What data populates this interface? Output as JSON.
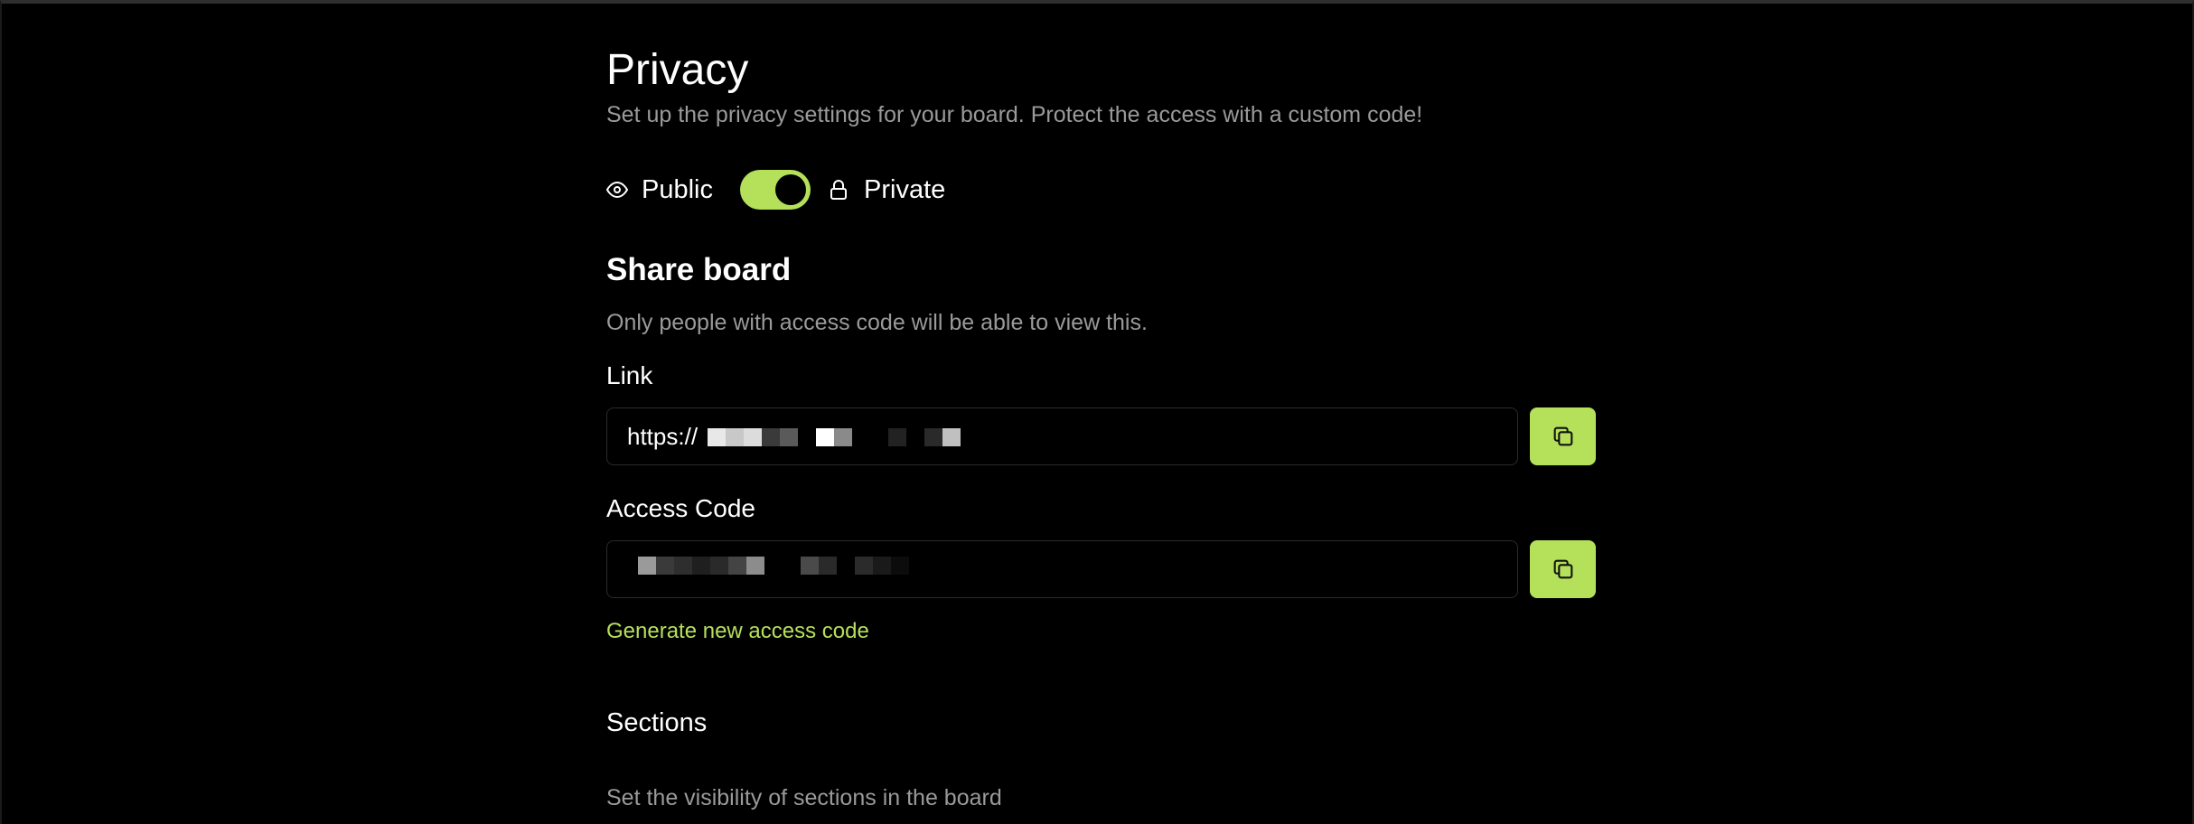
{
  "privacy": {
    "title": "Privacy",
    "subtitle": "Set up the privacy settings for your board. Protect the access with a custom code!",
    "public_label": "Public",
    "private_label": "Private",
    "toggle_state": "private",
    "public_icon": "eye-icon",
    "private_icon": "lock-icon"
  },
  "share": {
    "heading": "Share board",
    "description": "Only people with access code will be able to view this.",
    "link_label": "Link",
    "link_value": "https://",
    "link_redacted": true,
    "access_code_label": "Access Code",
    "access_code_value": "",
    "access_code_redacted": true,
    "copy_icon": "copy-icon",
    "generate_label": "Generate new access code"
  },
  "sections": {
    "heading": "Sections",
    "description": "Set the visibility of sections in the board"
  },
  "colors": {
    "background": "#000000",
    "accent": "#b5e05a",
    "muted_text": "#9a9a9a",
    "input_border": "#2a2a2a"
  }
}
